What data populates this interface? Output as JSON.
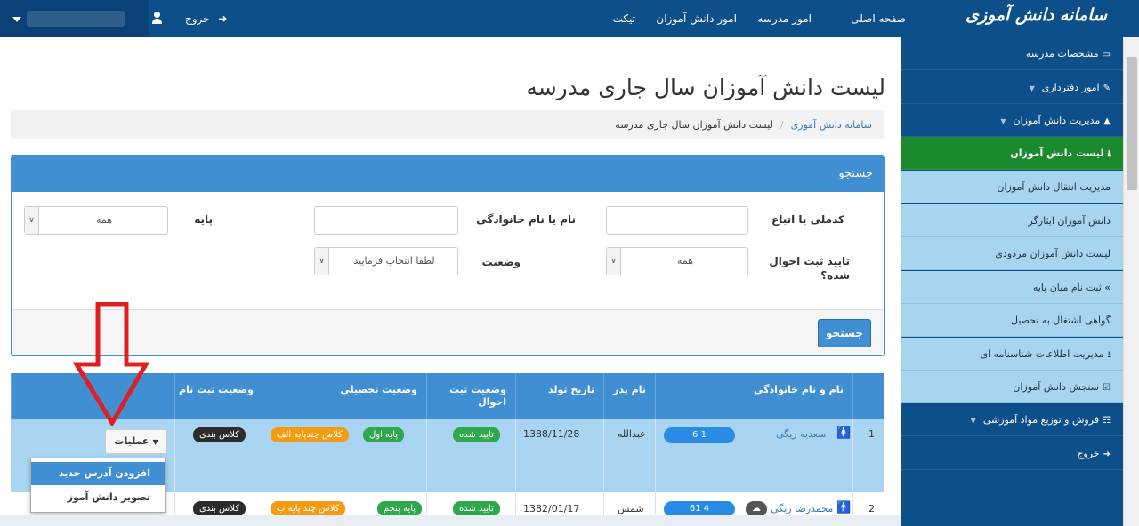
{
  "header": {
    "brand": "سامانه دانش آموزی",
    "nav": [
      "صفحه اصلی",
      "امور مدرسه",
      "امور دانش آموزان",
      "تیکت"
    ],
    "logout": "خروج"
  },
  "sidebar": {
    "items": [
      {
        "label": "مشخصات مدرسه",
        "icon": "monitor-icon",
        "type": "main"
      },
      {
        "label": "امور دفترداری",
        "icon": "edit-icon",
        "type": "main",
        "dropdown": true
      },
      {
        "label": "مدیریت دانش آموزان",
        "icon": "graduation-cap-icon",
        "type": "main",
        "dropdown": true
      },
      {
        "label": "لیست دانش آموزان",
        "icon": "user-download-icon",
        "type": "active"
      },
      {
        "label": "مدیریت انتقال دانش آموزان",
        "type": "sub"
      },
      {
        "label": "دانش آموزان ایثارگر",
        "type": "sub"
      },
      {
        "label": "لیست دانش آموزان مردودی",
        "type": "sub"
      },
      {
        "label": "» ثبت نام میان پایه",
        "type": "sub"
      },
      {
        "label": "گواهی اشتغال به تحصیل",
        "type": "sub"
      },
      {
        "label": "مدیریت اطلاعات شناسنامه ای",
        "icon": "user-download-icon",
        "type": "sub"
      },
      {
        "label": "سنجش دانش آموزان",
        "icon": "check-square-icon",
        "type": "sub"
      },
      {
        "label": "فروش و توزیع مواد آموزشی",
        "icon": "cart-icon",
        "type": "main",
        "dropdown": true
      },
      {
        "label": "خروج",
        "icon": "sign-out-icon",
        "type": "main"
      }
    ]
  },
  "page": {
    "title": "لیست دانش آموزان سال جاری مدرسه",
    "breadcrumb": [
      "سامانه دانش آموری",
      "لیست دانش آموزان سال جاری مدرسه"
    ]
  },
  "search": {
    "header": "جستجو",
    "fields": {
      "national_code_label": "کدملی یا اتباع",
      "name_label": "نام یا نام خانوادگی",
      "grade_label": "پایه",
      "grade_value": "همه",
      "approval_label": "تایید ثبت احوال شده؟",
      "approval_value": "همه",
      "status_label": "وضعیت",
      "status_placeholder": "لطفا انتخاب فرمایید"
    },
    "button": "جستجو"
  },
  "table": {
    "headers": [
      "نام و نام خانوادگی",
      "نام پدر",
      "تاریخ تولد",
      "وضعیت ثبت احوال",
      "وضعیت تحصیلی",
      "وضعیت ثبت نام"
    ],
    "rows": [
      {
        "num": "1",
        "name": "سعدیه ریگی",
        "id_pill": "6 1",
        "father": "عبدالله",
        "birth": "1388/11/28",
        "civil": "تایید شده",
        "grade": "پایه اول",
        "class_type": "کلاس چندپایه الف",
        "reg": "کلاس بندی",
        "gender": "female"
      },
      {
        "num": "2",
        "name": "محمدرضا ریگی",
        "id_pill": "61 4",
        "father": "شمس",
        "birth": "1382/01/17",
        "civil": "تایید شده",
        "grade": "پایه پنجم",
        "class_type": "کلاس چند پایه ب",
        "reg": "کلاس بندی",
        "gender": "male"
      }
    ],
    "ops_button": "عملیات",
    "ops_menu": [
      "افزودن آدرس جدید",
      "تصویر دانش آموز"
    ]
  },
  "colors": {
    "topbar": "#0d4f8b",
    "accent": "#3f8fd2",
    "active": "#1b8a2e",
    "arrow": "#e02020"
  }
}
